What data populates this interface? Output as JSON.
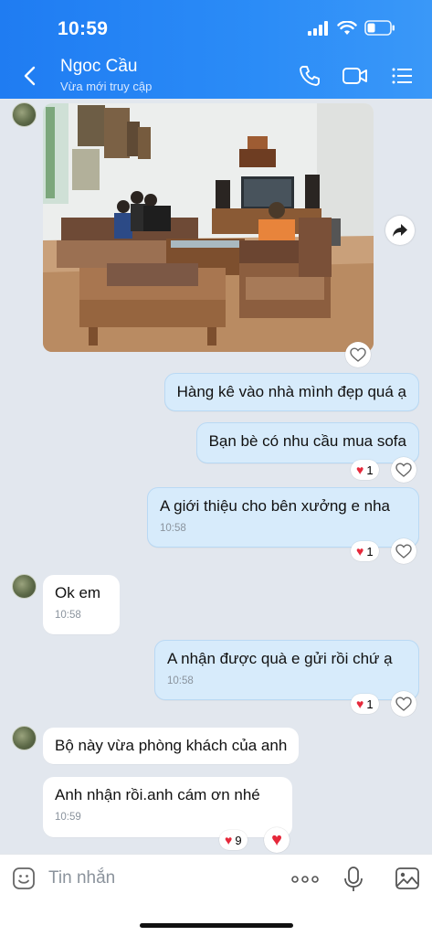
{
  "status": {
    "time": "10:59"
  },
  "header": {
    "name": "Ngoc Cầu",
    "presence": "Vừa mới truy cập"
  },
  "messages": {
    "m1": "Hàng kê vào nhà mình đẹp quá ạ",
    "m2": "Bạn bè có nhu cầu mua sofa",
    "m3": "A giới thiệu cho bên xưởng e nha",
    "m3_time": "10:58",
    "m3_reactions": "1",
    "m2_reactions": "1",
    "m4": "Ok em",
    "m4_time": "10:58",
    "m5": "A nhận được quà e gửi rồi chứ ạ",
    "m5_time": "10:58",
    "m5_reactions": "1",
    "m6": "Bộ này vừa phòng khách của anh",
    "m7": "Anh nhận rồi.anh cám ơn nhé",
    "m7_time": "10:59",
    "m7_reactions": "9"
  },
  "input": {
    "placeholder": "Tin nhắn"
  },
  "colors": {
    "header_blue": "#2b8cf7",
    "heart_red": "#e5283a",
    "mine_bubble": "#d7ebfb"
  },
  "icons": [
    "back-arrow-icon",
    "phone-icon",
    "video-call-icon",
    "menu-icon",
    "share-forward-icon",
    "heart-icon",
    "sticker-icon",
    "more-icon",
    "microphone-icon",
    "image-icon"
  ]
}
